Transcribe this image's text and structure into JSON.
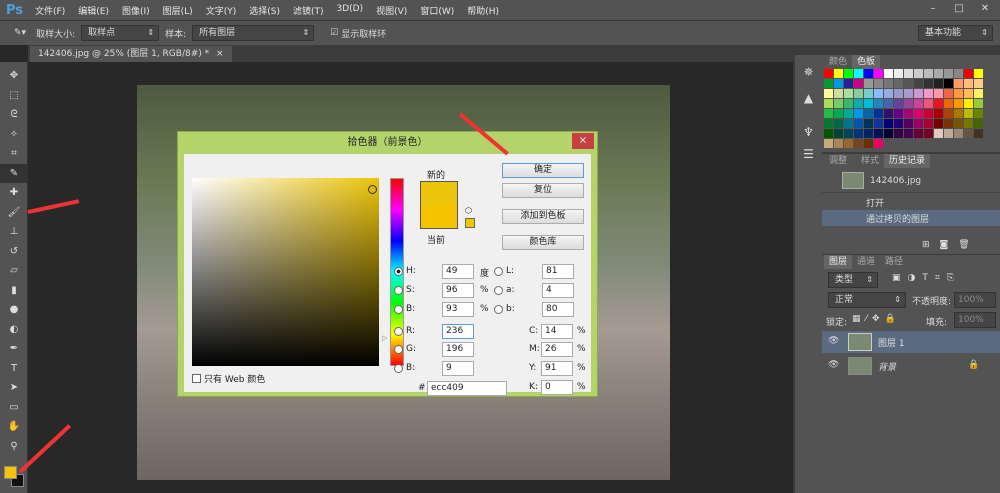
{
  "app": {
    "logo": "Ps"
  },
  "menu": [
    "文件(F)",
    "编辑(E)",
    "图像(I)",
    "图层(L)",
    "文字(Y)",
    "选择(S)",
    "滤镜(T)",
    "3D(D)",
    "视图(V)",
    "窗口(W)",
    "帮助(H)"
  ],
  "options": {
    "sample_size_label": "取样大小:",
    "sample_size_value": "取样点",
    "sample_label": "样本:",
    "sample_value": "所有图层",
    "show_ring_label": "显示取样环",
    "workspace": "基本功能"
  },
  "document_tab": {
    "title": "142406.jpg @ 25% (图层 1, RGB/8#) *",
    "close": "×"
  },
  "dialog": {
    "title": "拾色器（前景色）",
    "close": "×",
    "new_label": "新的",
    "current_label": "当前",
    "new_color": "#ecc409",
    "current_color": "#f5c400",
    "buttons": {
      "ok": "确定",
      "reset": "复位",
      "add_swatch": "添加到色板",
      "libraries": "颜色库"
    },
    "web_only": "只有 Web 颜色",
    "fields": {
      "H": {
        "label": "H:",
        "value": "49",
        "unit": "度"
      },
      "S": {
        "label": "S:",
        "value": "96",
        "unit": "%"
      },
      "Bv": {
        "label": "B:",
        "value": "93",
        "unit": "%"
      },
      "R": {
        "label": "R:",
        "value": "236"
      },
      "G": {
        "label": "G:",
        "value": "196"
      },
      "Bl": {
        "label": "B:",
        "value": "9"
      },
      "L": {
        "label": "L:",
        "value": "81"
      },
      "a": {
        "label": "a:",
        "value": "4"
      },
      "b": {
        "label": "b:",
        "value": "80"
      },
      "C": {
        "label": "C:",
        "value": "14",
        "unit": "%"
      },
      "M": {
        "label": "M:",
        "value": "26",
        "unit": "%"
      },
      "Y": {
        "label": "Y:",
        "value": "91",
        "unit": "%"
      },
      "K": {
        "label": "K:",
        "value": "0",
        "unit": "%"
      },
      "hex": {
        "label": "#",
        "value": "ecc409"
      }
    }
  },
  "swatches_panel": {
    "tabs": [
      "颜色",
      "色板"
    ],
    "colors": [
      "#f00",
      "#ff0",
      "#0f0",
      "#0ff",
      "#00f",
      "#f0f",
      "#fff",
      "#eee",
      "#ddd",
      "#ccc",
      "#bbb",
      "#aaa",
      "#999",
      "#888",
      "#e00",
      "#ff0",
      "#093",
      "#09d",
      "#229",
      "#c08",
      "#999",
      "#888",
      "#777",
      "#666",
      "#555",
      "#444",
      "#333",
      "#222",
      "#000",
      "#f96",
      "#fb7",
      "#fc8",
      "#ff9",
      "#cd9",
      "#ad9",
      "#8c9",
      "#7cc",
      "#8bf",
      "#9ad",
      "#99c",
      "#a9c",
      "#c9c",
      "#e9c",
      "#f9a",
      "#e64",
      "#f94",
      "#fb5",
      "#fe6",
      "#ad5",
      "#7c6",
      "#3b6",
      "#1aa",
      "#0bd",
      "#28b",
      "#46a",
      "#649",
      "#949",
      "#c49",
      "#e57",
      "#e12",
      "#e60",
      "#f90",
      "#fe0",
      "#9c3",
      "#2b4",
      "#0a5",
      "#0a9",
      "#09e",
      "#06a",
      "#039",
      "#316",
      "#608",
      "#a07",
      "#d06",
      "#c03",
      "#a00",
      "#a40",
      "#a70",
      "#bb0",
      "#680",
      "#073",
      "#064",
      "#078",
      "#05a",
      "#035",
      "#139",
      "#007",
      "#207",
      "#506",
      "#906",
      "#a03",
      "#700",
      "#730",
      "#750",
      "#770",
      "#460",
      "#050",
      "#043",
      "#045",
      "#037",
      "#026",
      "#015",
      "#003",
      "#304",
      "#405",
      "#603",
      "#702",
      "#dcb",
      "#ba9",
      "#987",
      "#654",
      "#432",
      "#ca7",
      "#a85",
      "#963",
      "#742",
      "#630",
      "#e06"
    ]
  },
  "history_panel": {
    "tabs": [
      "调整",
      "样式",
      "历史记录"
    ],
    "snapshot": "142406.jpg",
    "items": [
      "打开",
      "通过拷贝的图层"
    ]
  },
  "layers_panel": {
    "tabs": [
      "图层",
      "通道",
      "路径"
    ],
    "filter": "类型",
    "blend_mode": "正常",
    "opacity_label": "不透明度:",
    "opacity": "100%",
    "lock_label": "锁定:",
    "fill_label": "填充:",
    "fill": "100%",
    "layers": [
      {
        "name": "图层 1"
      },
      {
        "name": "背景"
      }
    ]
  },
  "tools": {
    "foreground": "#f5c400",
    "background": "#111111"
  }
}
